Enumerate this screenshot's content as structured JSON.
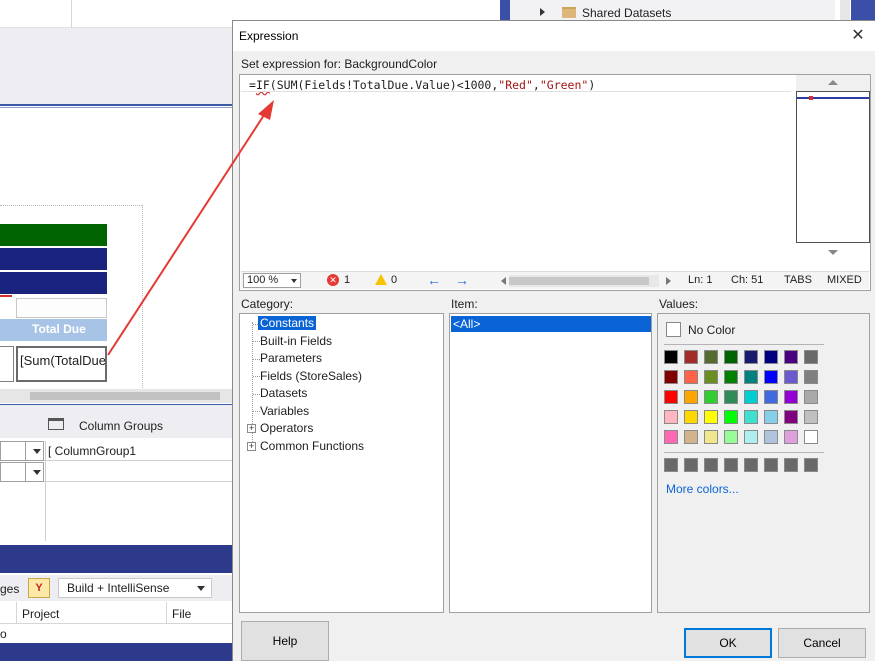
{
  "background": {
    "shared_datasets": "Shared Datasets",
    "column_header": "Total Due",
    "cell_text": "[Sum(TotalDue",
    "column_groups_label": "Column Groups",
    "column_group_name": "[ ColumnGroup1",
    "toolbar_left_text": "ges",
    "build_combo": "Build + IntelliSense",
    "col_project": "Project",
    "col_file": "File",
    "row_text": "o"
  },
  "dialog": {
    "title": "Expression",
    "close_glyph": "✕",
    "set_label": "Set expression for: BackgroundColor",
    "code": {
      "prefix": "=",
      "func": "IF",
      "middle": "(SUM(Fields!TotalDue.Value)<1000,",
      "str1": "\"Red\"",
      "comma": ",",
      "str2": "\"Green\"",
      "suffix": ")"
    },
    "status": {
      "zoom": "100 %",
      "errors": "1",
      "warnings": "0",
      "line": "Ln: 1",
      "col": "Ch: 51",
      "tabs": "TABS",
      "mixed": "MIXED"
    },
    "category_label": "Category:",
    "item_label": "Item:",
    "values_label": "Values:",
    "categories": [
      "Constants",
      "Built-in Fields",
      "Parameters",
      "Fields (StoreSales)",
      "Datasets",
      "Variables",
      "Operators",
      "Common Functions"
    ],
    "item_selected": "<All>",
    "no_color": "No Color",
    "more_colors": "More colors...",
    "buttons": {
      "help": "Help",
      "ok": "OK",
      "cancel": "Cancel"
    }
  },
  "palette": [
    [
      "#000000",
      "#a52a2a",
      "#556b2f",
      "#006400",
      "#191970",
      "#000080",
      "#4b0082",
      "#696969"
    ],
    [
      "#800000",
      "#ff6347",
      "#6b8e23",
      "#008000",
      "#008080",
      "#0000ff",
      "#6a5acd",
      "#808080"
    ],
    [
      "#ff0000",
      "#ffa500",
      "#32cd32",
      "#2e8b57",
      "#00ced1",
      "#4169e1",
      "#9400d3",
      "#a9a9a9"
    ],
    [
      "#ffb6c1",
      "#ffd700",
      "#ffff00",
      "#00ff00",
      "#40e0d0",
      "#87ceeb",
      "#800080",
      "#c0c0c0"
    ],
    [
      "#ff69b4",
      "#d2b48c",
      "#f0e68c",
      "#98fb98",
      "#afeeee",
      "#b0c4de",
      "#dda0dd",
      "#ffffff"
    ]
  ],
  "custom_row": [
    "#696969",
    "#696969",
    "#696969",
    "#696969",
    "#696969",
    "#696969",
    "#696969",
    "#696969"
  ],
  "colors": {
    "accent": "#0a64d6",
    "arrow": "#e53935",
    "band_green": "#006400",
    "band_navy": "#1a237e"
  }
}
